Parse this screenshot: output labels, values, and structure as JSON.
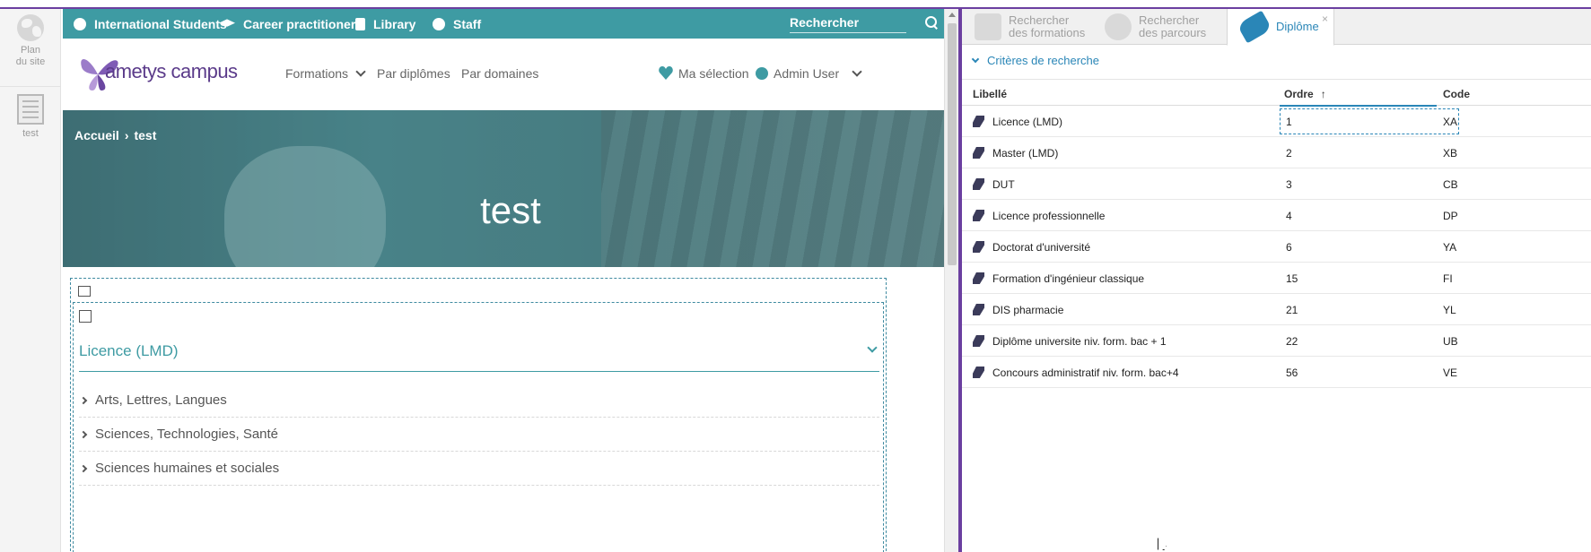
{
  "left_rail": {
    "items": [
      {
        "label_line1": "Plan",
        "label_line2": "du site",
        "icon": "globe-icon"
      },
      {
        "label_line1": "test",
        "label_line2": "",
        "icon": "page-icon"
      }
    ]
  },
  "site": {
    "topbar": {
      "links": [
        {
          "label": "International Students",
          "icon": "globe-icon"
        },
        {
          "label": "Career practitioners",
          "icon": "graduation-cap-icon"
        },
        {
          "label": "Library",
          "icon": "book-icon"
        },
        {
          "label": "Staff",
          "icon": "user-circle-icon"
        }
      ],
      "search_placeholder": "Rechercher",
      "accent": "#3e9ba3"
    },
    "header": {
      "logo_text": "ametys campus",
      "menu": [
        {
          "label": "Formations",
          "has_dropdown": true
        },
        {
          "label": "Par diplômes",
          "has_dropdown": false
        },
        {
          "label": "Par domaines",
          "has_dropdown": false
        }
      ],
      "selection_label": "Ma sélection",
      "user_label": "Admin User"
    },
    "hero": {
      "breadcrumb": [
        "Accueil",
        "test"
      ],
      "title": "test"
    },
    "content": {
      "section_title": "Licence (LMD)",
      "accordion": [
        {
          "label": "Arts, Lettres, Langues"
        },
        {
          "label": "Sciences, Technologies, Santé"
        },
        {
          "label": "Sciences humaines et sociales"
        }
      ]
    }
  },
  "panel": {
    "tabs": [
      {
        "line1": "Rechercher",
        "line2": "des formations",
        "active": false
      },
      {
        "line1": "Rechercher",
        "line2": "des parcours",
        "active": false
      },
      {
        "line1": "Diplôme",
        "line2": "",
        "active": true,
        "close": "×"
      }
    ],
    "criteria_label": "Critères de recherche",
    "grid": {
      "columns": [
        "Libellé",
        "Ordre",
        "Code"
      ],
      "sorted_column": "Ordre",
      "sort_direction": "ascending",
      "rows": [
        {
          "label": "Licence (LMD)",
          "order": "1",
          "code": "XA"
        },
        {
          "label": "Master (LMD)",
          "order": "2",
          "code": "XB"
        },
        {
          "label": "DUT",
          "order": "3",
          "code": "CB"
        },
        {
          "label": "Licence professionnelle",
          "order": "4",
          "code": "DP"
        },
        {
          "label": "Doctorat d'université",
          "order": "6",
          "code": "YA"
        },
        {
          "label": "Formation d'ingénieur classique",
          "order": "15",
          "code": "FI"
        },
        {
          "label": "DIS pharmacie",
          "order": "21",
          "code": "YL"
        },
        {
          "label": "Diplôme universite niv. form. bac + 1",
          "order": "22",
          "code": "UB"
        },
        {
          "label": "Concours administratif niv. form. bac+4",
          "order": "56",
          "code": "VE"
        }
      ]
    },
    "accent": "#2a86b7",
    "splitter_color": "#6b3fa0"
  }
}
